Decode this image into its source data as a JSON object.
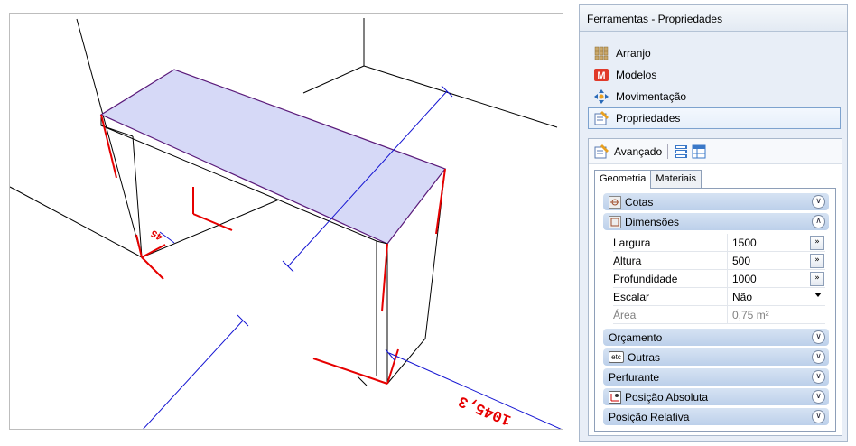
{
  "panel": {
    "title": "Ferramentas - Propriedades",
    "nav": [
      {
        "label": "Arranjo",
        "icon": "arranjo-icon"
      },
      {
        "label": "Modelos",
        "icon": "modelos-icon"
      },
      {
        "label": "Movimentação",
        "icon": "move-icon"
      },
      {
        "label": "Propriedades",
        "icon": "properties-icon",
        "active": true
      }
    ]
  },
  "props": {
    "toolbar_label": "Avançado",
    "tabs": [
      "Geometria",
      "Materiais"
    ],
    "sections": {
      "cotas": "Cotas",
      "dimensoes": "Dimensões",
      "orcamento": "Orçamento",
      "outras": "Outras",
      "perfurante": "Perfurante",
      "posicao_absoluta": "Posição Absoluta",
      "posicao_relativa": "Posição Relativa"
    },
    "fields": {
      "largura": {
        "label": "Largura",
        "value": "1500"
      },
      "altura": {
        "label": "Altura",
        "value": "500"
      },
      "profundidade": {
        "label": "Profundidade",
        "value": "1000"
      },
      "escalar": {
        "label": "Escalar",
        "value": "Não"
      },
      "area": {
        "label": "Área",
        "value": "0,75 m²"
      }
    },
    "outras_icon_text": "etc"
  },
  "viewport": {
    "dimension_label_1": "1045,3",
    "dimension_label_2": "45"
  },
  "colors": {
    "selection_fill": "#d6d9f7",
    "dimension_line": "#1414d2",
    "axis_red": "#e60000",
    "panel_bg": "#e8eef7",
    "section_header": "#c8d9ef"
  }
}
